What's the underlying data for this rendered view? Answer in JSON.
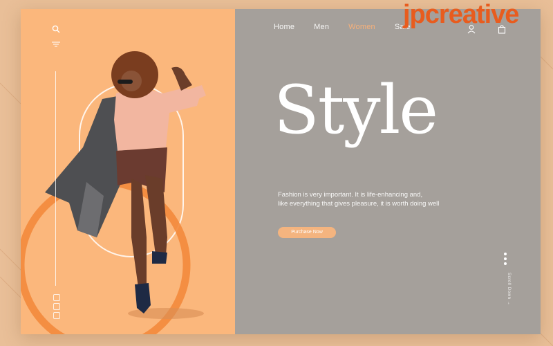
{
  "nav": {
    "items": [
      {
        "label": "Home"
      },
      {
        "label": "Men"
      },
      {
        "label": "Women"
      },
      {
        "label": "Sale"
      }
    ],
    "active_index": 2
  },
  "hero": {
    "title": "Style",
    "tagline_line1": "Fashion is very important. It is life-enhancing and,",
    "tagline_line2": "like everything that gives pleasure, it is worth doing well",
    "cta_label": "Purchase Now"
  },
  "side": {
    "scroll_label": "Scroll Down →"
  },
  "watermark": {
    "text": "jpcreative"
  },
  "colors": {
    "accent": "#f6b07a",
    "left_panel": "#fbb77c",
    "right_panel": "#a5a09b",
    "page_bg": "#e9bf98",
    "brand": "#e85c1e"
  },
  "icons": [
    "search-icon",
    "filter-icon",
    "user-icon",
    "bag-icon",
    "social-icons"
  ]
}
